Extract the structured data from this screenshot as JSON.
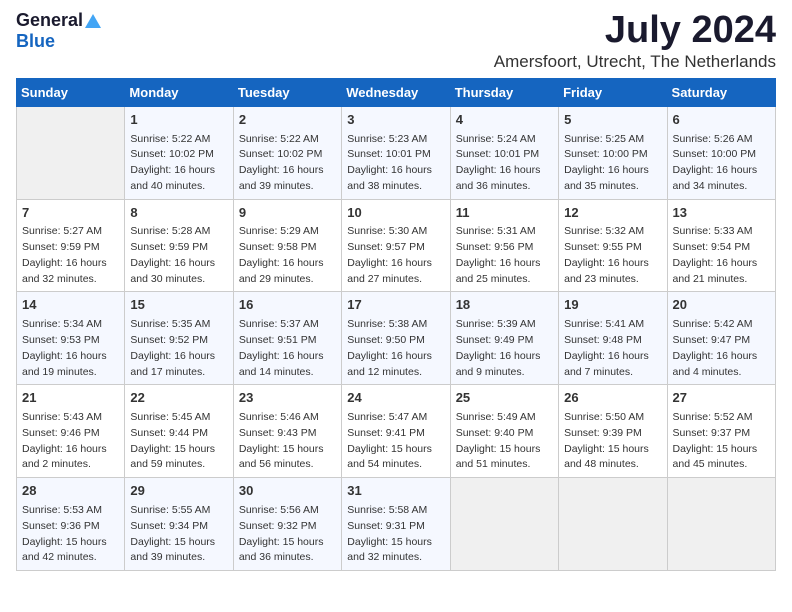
{
  "logo": {
    "general": "General",
    "blue": "Blue"
  },
  "title": "July 2024",
  "location": "Amersfoort, Utrecht, The Netherlands",
  "weekdays": [
    "Sunday",
    "Monday",
    "Tuesday",
    "Wednesday",
    "Thursday",
    "Friday",
    "Saturday"
  ],
  "weeks": [
    [
      {
        "day": "",
        "info": ""
      },
      {
        "day": "1",
        "info": "Sunrise: 5:22 AM\nSunset: 10:02 PM\nDaylight: 16 hours\nand 40 minutes."
      },
      {
        "day": "2",
        "info": "Sunrise: 5:22 AM\nSunset: 10:02 PM\nDaylight: 16 hours\nand 39 minutes."
      },
      {
        "day": "3",
        "info": "Sunrise: 5:23 AM\nSunset: 10:01 PM\nDaylight: 16 hours\nand 38 minutes."
      },
      {
        "day": "4",
        "info": "Sunrise: 5:24 AM\nSunset: 10:01 PM\nDaylight: 16 hours\nand 36 minutes."
      },
      {
        "day": "5",
        "info": "Sunrise: 5:25 AM\nSunset: 10:00 PM\nDaylight: 16 hours\nand 35 minutes."
      },
      {
        "day": "6",
        "info": "Sunrise: 5:26 AM\nSunset: 10:00 PM\nDaylight: 16 hours\nand 34 minutes."
      }
    ],
    [
      {
        "day": "7",
        "info": "Sunrise: 5:27 AM\nSunset: 9:59 PM\nDaylight: 16 hours\nand 32 minutes."
      },
      {
        "day": "8",
        "info": "Sunrise: 5:28 AM\nSunset: 9:59 PM\nDaylight: 16 hours\nand 30 minutes."
      },
      {
        "day": "9",
        "info": "Sunrise: 5:29 AM\nSunset: 9:58 PM\nDaylight: 16 hours\nand 29 minutes."
      },
      {
        "day": "10",
        "info": "Sunrise: 5:30 AM\nSunset: 9:57 PM\nDaylight: 16 hours\nand 27 minutes."
      },
      {
        "day": "11",
        "info": "Sunrise: 5:31 AM\nSunset: 9:56 PM\nDaylight: 16 hours\nand 25 minutes."
      },
      {
        "day": "12",
        "info": "Sunrise: 5:32 AM\nSunset: 9:55 PM\nDaylight: 16 hours\nand 23 minutes."
      },
      {
        "day": "13",
        "info": "Sunrise: 5:33 AM\nSunset: 9:54 PM\nDaylight: 16 hours\nand 21 minutes."
      }
    ],
    [
      {
        "day": "14",
        "info": "Sunrise: 5:34 AM\nSunset: 9:53 PM\nDaylight: 16 hours\nand 19 minutes."
      },
      {
        "day": "15",
        "info": "Sunrise: 5:35 AM\nSunset: 9:52 PM\nDaylight: 16 hours\nand 17 minutes."
      },
      {
        "day": "16",
        "info": "Sunrise: 5:37 AM\nSunset: 9:51 PM\nDaylight: 16 hours\nand 14 minutes."
      },
      {
        "day": "17",
        "info": "Sunrise: 5:38 AM\nSunset: 9:50 PM\nDaylight: 16 hours\nand 12 minutes."
      },
      {
        "day": "18",
        "info": "Sunrise: 5:39 AM\nSunset: 9:49 PM\nDaylight: 16 hours\nand 9 minutes."
      },
      {
        "day": "19",
        "info": "Sunrise: 5:41 AM\nSunset: 9:48 PM\nDaylight: 16 hours\nand 7 minutes."
      },
      {
        "day": "20",
        "info": "Sunrise: 5:42 AM\nSunset: 9:47 PM\nDaylight: 16 hours\nand 4 minutes."
      }
    ],
    [
      {
        "day": "21",
        "info": "Sunrise: 5:43 AM\nSunset: 9:46 PM\nDaylight: 16 hours\nand 2 minutes."
      },
      {
        "day": "22",
        "info": "Sunrise: 5:45 AM\nSunset: 9:44 PM\nDaylight: 15 hours\nand 59 minutes."
      },
      {
        "day": "23",
        "info": "Sunrise: 5:46 AM\nSunset: 9:43 PM\nDaylight: 15 hours\nand 56 minutes."
      },
      {
        "day": "24",
        "info": "Sunrise: 5:47 AM\nSunset: 9:41 PM\nDaylight: 15 hours\nand 54 minutes."
      },
      {
        "day": "25",
        "info": "Sunrise: 5:49 AM\nSunset: 9:40 PM\nDaylight: 15 hours\nand 51 minutes."
      },
      {
        "day": "26",
        "info": "Sunrise: 5:50 AM\nSunset: 9:39 PM\nDaylight: 15 hours\nand 48 minutes."
      },
      {
        "day": "27",
        "info": "Sunrise: 5:52 AM\nSunset: 9:37 PM\nDaylight: 15 hours\nand 45 minutes."
      }
    ],
    [
      {
        "day": "28",
        "info": "Sunrise: 5:53 AM\nSunset: 9:36 PM\nDaylight: 15 hours\nand 42 minutes."
      },
      {
        "day": "29",
        "info": "Sunrise: 5:55 AM\nSunset: 9:34 PM\nDaylight: 15 hours\nand 39 minutes."
      },
      {
        "day": "30",
        "info": "Sunrise: 5:56 AM\nSunset: 9:32 PM\nDaylight: 15 hours\nand 36 minutes."
      },
      {
        "day": "31",
        "info": "Sunrise: 5:58 AM\nSunset: 9:31 PM\nDaylight: 15 hours\nand 32 minutes."
      },
      {
        "day": "",
        "info": ""
      },
      {
        "day": "",
        "info": ""
      },
      {
        "day": "",
        "info": ""
      }
    ]
  ]
}
